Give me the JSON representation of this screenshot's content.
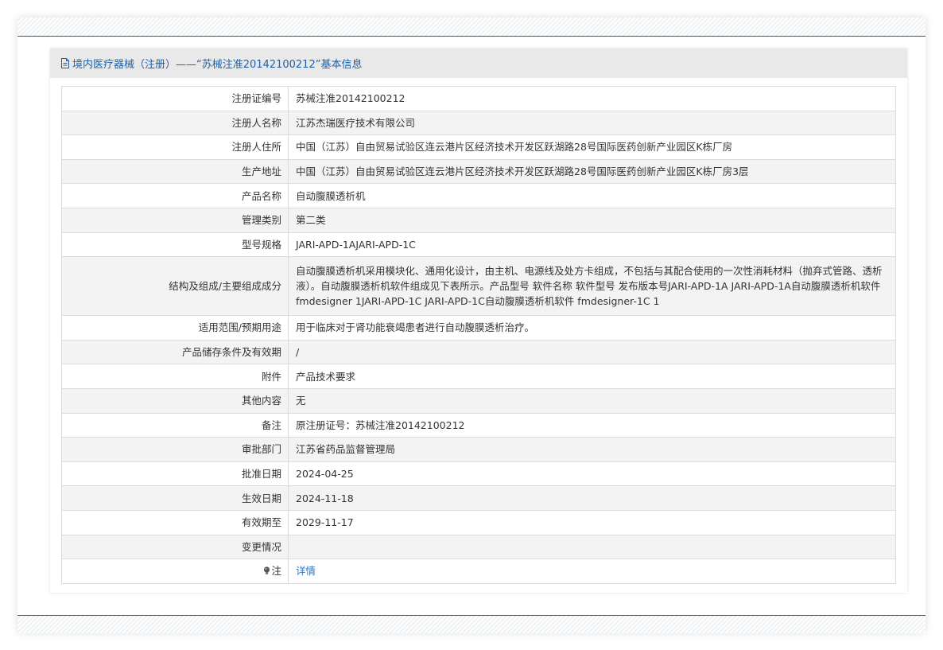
{
  "header": {
    "title": "境内医疗器械（注册）——“苏械注准20142100212”基本信息",
    "icon": "document-icon"
  },
  "rows": [
    {
      "label": "注册证编号",
      "value": "苏械注准20142100212"
    },
    {
      "label": "注册人名称",
      "value": "江苏杰瑞医疗技术有限公司"
    },
    {
      "label": "注册人住所",
      "value": "中国（江苏）自由贸易试验区连云港片区经济技术开发区跃湖路28号国际医药创新产业园区K栋厂房"
    },
    {
      "label": "生产地址",
      "value": "中国（江苏）自由贸易试验区连云港片区经济技术开发区跃湖路28号国际医药创新产业园区K栋厂房3层"
    },
    {
      "label": "产品名称",
      "value": "自动腹膜透析机"
    },
    {
      "label": "管理类别",
      "value": "第二类"
    },
    {
      "label": "型号规格",
      "value": "JARI-APD-1AJARI-APD-1C"
    },
    {
      "label": "结构及组成/主要组成成分",
      "value": "自动腹膜透析机采用模块化、通用化设计，由主机、电源线及处方卡组成，不包括与其配合使用的一次性消耗材料（抛弃式管路、透析液）。自动腹膜透析机软件组成见下表所示。产品型号 软件名称 软件型号 发布版本号JARI-APD-1A JARI-APD-1A自动腹膜透析机软件 fmdesigner 1JARI-APD-1C JARI-APD-1C自动腹膜透析机软件 fmdesigner-1C 1"
    },
    {
      "label": "适用范围/预期用途",
      "value": "用于临床对于肾功能衰竭患者进行自动腹膜透析治疗。"
    },
    {
      "label": "产品储存条件及有效期",
      "value": "/"
    },
    {
      "label": "附件",
      "value": "产品技术要求"
    },
    {
      "label": "其他内容",
      "value": "无"
    },
    {
      "label": "备注",
      "value": "原注册证号：苏械注准20142100212"
    },
    {
      "label": "审批部门",
      "value": "江苏省药品监督管理局"
    },
    {
      "label": "批准日期",
      "value": "2024-04-25"
    },
    {
      "label": "生效日期",
      "value": "2024-11-18"
    },
    {
      "label": "有效期至",
      "value": "2029-11-17"
    },
    {
      "label": "变更情况",
      "value": ""
    }
  ],
  "note_row": {
    "label": "注",
    "icon": "lightbulb-icon",
    "link": "详情"
  },
  "colors": {
    "brand_blue": "#1f5fa8",
    "link_blue": "#2a76cc",
    "header_bg": "#e9e9e9",
    "row_alt_bg": "#f3f3f3"
  }
}
